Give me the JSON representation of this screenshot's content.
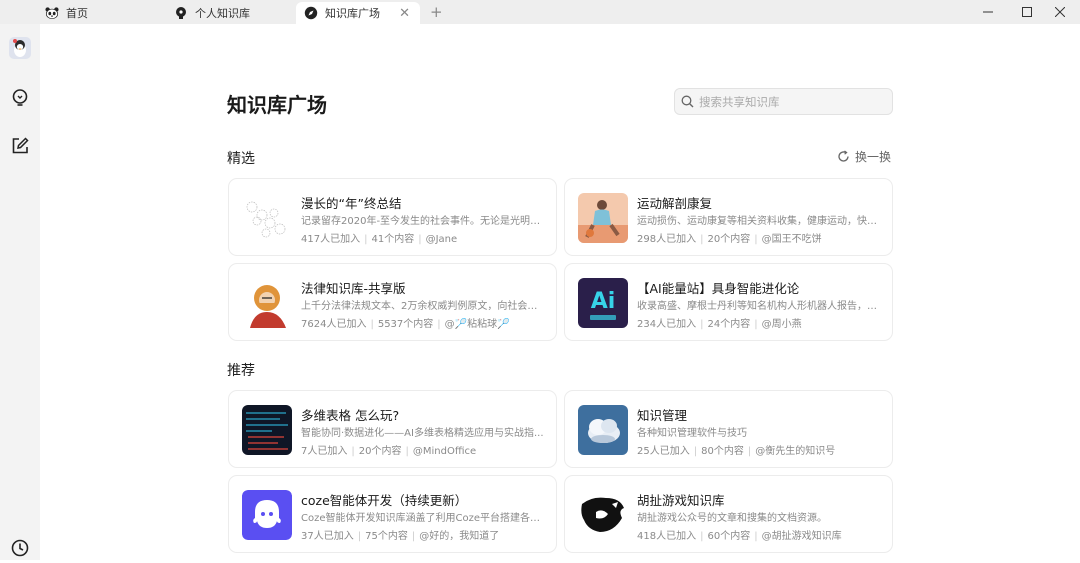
{
  "tabs": [
    {
      "label": "首页",
      "icon": "panda-icon"
    },
    {
      "label": "个人知识库",
      "icon": "bulb-icon"
    },
    {
      "label": "知识库广场",
      "icon": "compass-icon",
      "active": true
    }
  ],
  "window_controls": [
    "minimize-icon",
    "maximize-icon",
    "close-icon"
  ],
  "sidebar": {
    "items": [
      "avatar",
      "bulb-icon",
      "edit-icon",
      "history-icon"
    ]
  },
  "page": {
    "title": "知识库广场"
  },
  "search": {
    "placeholder": "搜索共享知识库",
    "value": ""
  },
  "featured": {
    "title": "精选",
    "refresh_label": "换一换",
    "cards": [
      {
        "title": "漫长的“年”终总结",
        "desc": "记录留存2020年-至今发生的社会事件。无论是光明的...",
        "members": "417人已加入",
        "count": "41个内容",
        "author": "@Jane",
        "thumb": "sketch"
      },
      {
        "title": "运动解剖康复",
        "desc": "运动损伤、运动康复等相关资料收集，健康运动，快乐...",
        "members": "298人已加入",
        "count": "20个内容",
        "author": "@国王不吃饼",
        "thumb": "sport"
      },
      {
        "title": "法律知识库-共享版",
        "desc": "上千分法律法规文本、2万余权威判例原文，向社会提...",
        "members": "7624人已加入",
        "count": "5537个内容",
        "author": "@🏸粘粘球🏸",
        "thumb": "law"
      },
      {
        "title": "【AI能量站】具身智能进化论",
        "desc": "收录高盛、摩根士丹利等知名机构人形机器人报告，追...",
        "members": "234人已加入",
        "count": "24个内容",
        "author": "@周小燕",
        "thumb": "ai"
      }
    ]
  },
  "recommended": {
    "title": "推荐",
    "cards": [
      {
        "title": "多维表格 怎么玩?",
        "desc": "智能协同·数据进化——AI多维表格精选应用与实战指...",
        "members": "7人已加入",
        "count": "20个内容",
        "author": "@MindOffice",
        "thumb": "grid"
      },
      {
        "title": "知识管理",
        "desc": "各种知识管理软件与技巧",
        "members": "25人已加入",
        "count": "80个内容",
        "author": "@衡先生的知识号",
        "thumb": "cloud"
      },
      {
        "title": "coze智能体开发（持续更新）",
        "desc": "Coze智能体开发知识库涵盖了利用Coze平台搭建各种A...",
        "members": "37人已加入",
        "count": "75个内容",
        "author": "@好的，我知道了",
        "thumb": "coze"
      },
      {
        "title": "胡扯游戏知识库",
        "desc": "胡扯游戏公众号的文章和搜集的文档资源。",
        "members": "418人已加入",
        "count": "60个内容",
        "author": "@胡扯游戏知识库",
        "thumb": "game"
      }
    ]
  },
  "colors": {
    "accent": "#5a4ff2",
    "ai_bg": "#2a1f4a",
    "ai_text": "#37d3e8"
  }
}
